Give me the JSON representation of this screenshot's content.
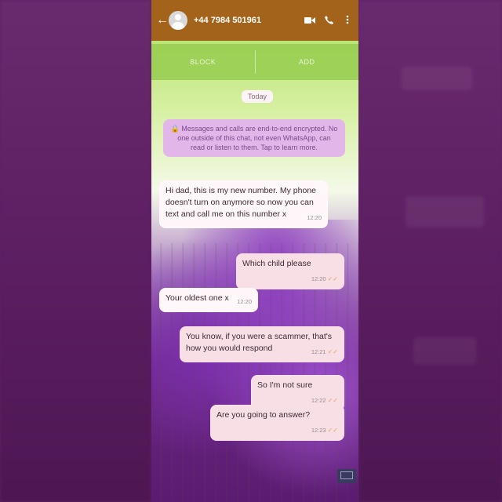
{
  "header": {
    "back_icon": "back-arrow-icon",
    "contact_number": "+44 7984 501961",
    "icons": [
      "video-call-icon",
      "phone-icon",
      "more-vertical-icon"
    ],
    "bg_color": "#a4631a"
  },
  "actions": {
    "block_label": "BLOCK",
    "add_label": "ADD"
  },
  "date_separator": "Today",
  "encryption_notice": "🔒 Messages and calls are end-to-end encrypted. No one outside of this chat, not even WhatsApp, can read or listen to them. Tap to learn more.",
  "messages": [
    {
      "direction": "incoming",
      "text": "Hi dad, this is my new number. My phone doesn't turn on anymore so now you can text and call me on this number x",
      "time": "12:20"
    },
    {
      "direction": "outgoing",
      "text": "Which child please",
      "time": "12:20",
      "read_icon": "double-check-icon"
    },
    {
      "direction": "incoming",
      "text": "Your oldest one x",
      "time": "12:20"
    },
    {
      "direction": "outgoing",
      "text": "You know, if you were a scammer, that's how you would respond",
      "time": "12:21",
      "read_icon": "double-check-icon"
    },
    {
      "direction": "outgoing",
      "text": "So I'm not sure",
      "time": "12:22",
      "read_icon": "double-check-icon"
    },
    {
      "direction": "outgoing",
      "text": "Are you going to answer?",
      "time": "12:23",
      "read_icon": "double-check-icon"
    }
  ],
  "colors": {
    "incoming_bubble": "#fff7f9",
    "outgoing_bubble": "#f8dfe6",
    "notice_bubble": "#e3b6ea",
    "background": "#5e1f63"
  }
}
